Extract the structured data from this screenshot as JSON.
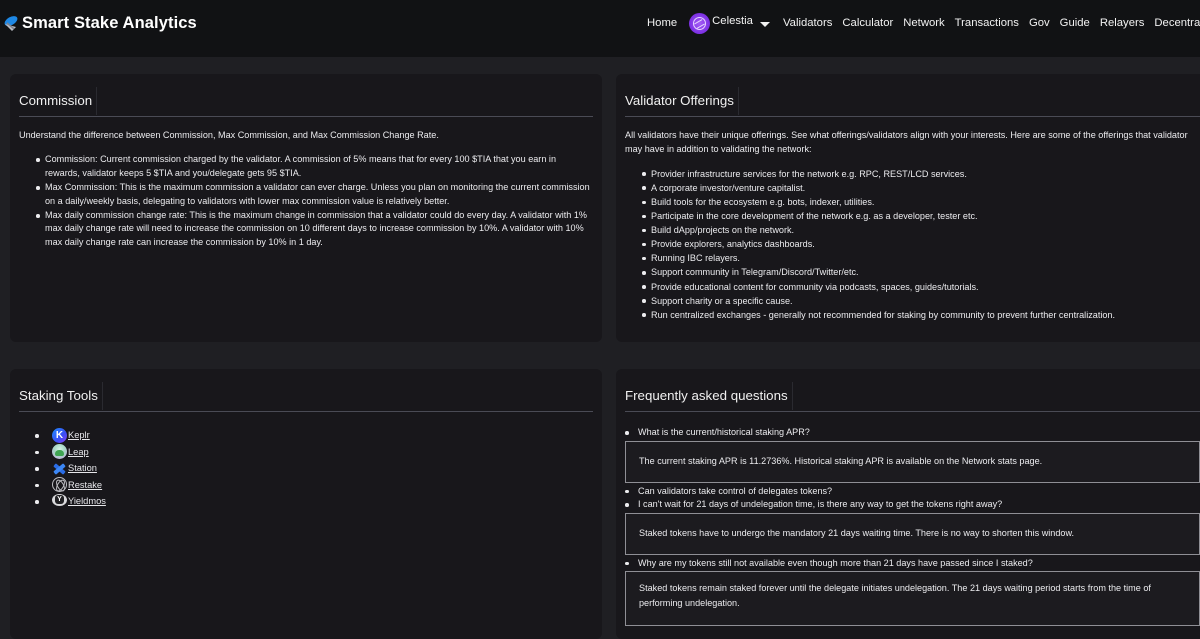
{
  "header": {
    "brand_title": "Smart Stake Analytics",
    "brand_icon": "satellite-dish-icon",
    "nav": {
      "home": "Home",
      "network": {
        "label": "Celestia",
        "icon": "celestia-icon",
        "dropdown_icon": "caret-down-icon"
      },
      "items": [
        "Validators",
        "Calculator",
        "Network",
        "Transactions",
        "Gov",
        "Guide",
        "Relayers",
        "Decentralization"
      ]
    }
  },
  "commission": {
    "title": "Commission",
    "intro": "Understand the difference between Commission, Max Commission, and Max Commission Change Rate.",
    "items": [
      "Commission: Current commission charged by the validator. A commission of 5% means that for every 100 $TIA that you earn in rewards, validator keeps 5 $TIA and you/delegate gets 95 $TIA.",
      "Max Commission: This is the maximum commission a validator can ever charge. Unless you plan on monitoring the current commission on a daily/weekly basis, delegating to validators with lower max commission value is relatively better.",
      "Max daily commission change rate: This is the maximum change in commission that a validator could do every day. A validator with 1% max daily change rate will need to increase the commission on 10 different days to increase commission by 10%. A validator with 10% max daily change rate can increase the commission by 10% in 1 day."
    ]
  },
  "offerings": {
    "title": "Validator Offerings",
    "intro": "All validators have their unique offerings. See what offerings/validators align with your interests. Here are some of the offerings that validator may have in addition to validating the network:",
    "items": [
      "Provider infrastructure services for the network e.g. RPC, REST/LCD services.",
      "A corporate investor/venture capitalist.",
      "Build tools for the ecosystem e.g. bots, indexer, utilities.",
      "Participate in the core development of the network e.g. as a developer, tester etc.",
      "Build dApp/projects on the network.",
      "Provide explorers, analytics dashboards.",
      "Running IBC relayers.",
      "Support community in Telegram/Discord/Twitter/etc.",
      "Provide educational content for community via podcasts, spaces, guides/tutorials.",
      "Support charity or a specific cause.",
      "Run centralized exchanges - generally not recommended for staking by community to prevent further centralization."
    ]
  },
  "staking_tools": {
    "title": "Staking Tools",
    "items": [
      {
        "label": "Keplr",
        "icon": "keplr-icon"
      },
      {
        "label": "Leap",
        "icon": "leap-icon"
      },
      {
        "label": "Station",
        "icon": "station-icon"
      },
      {
        "label": "Restake",
        "icon": "restake-icon"
      },
      {
        "label": "Yieldmos",
        "icon": "yieldmos-icon"
      }
    ]
  },
  "faq": {
    "title": "Frequently asked questions",
    "items": [
      {
        "q": "What is the current/historical staking APR?",
        "a": "The current staking APR is 11.2736%. Historical staking APR is available on the Network stats page."
      },
      {
        "q": "Can validators take control of delegates tokens?"
      },
      {
        "q": "I can't wait for 21 days of undelegation time, is there any way to get the tokens right away?",
        "a": "Staked tokens have to undergo the mandatory 21 days waiting time. There is no way to shorten this window."
      },
      {
        "q": "Why are my tokens still not available even though more than 21 days have passed since I staked?",
        "a": "Staked tokens remain staked forever until the delegate initiates undelegation. The 21 days waiting period starts from the time of performing undelegation."
      }
    ]
  }
}
